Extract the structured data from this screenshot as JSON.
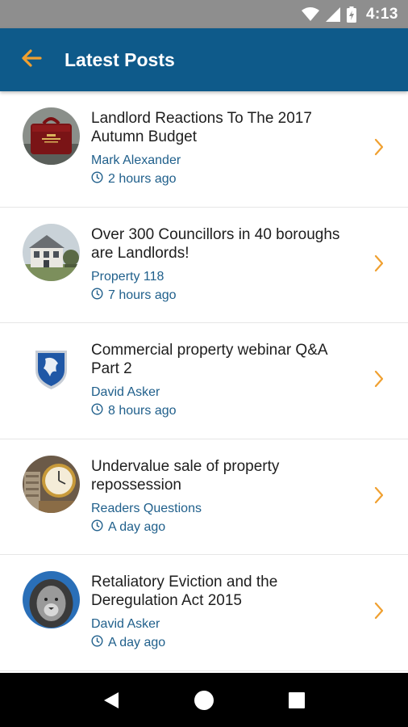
{
  "status_bar": {
    "time": "4:13",
    "icons": [
      "wifi-icon",
      "cell-signal-icon",
      "battery-charging-icon"
    ]
  },
  "app_bar": {
    "title": "Latest Posts",
    "back_icon": "arrow-left-icon",
    "accent_color": "#f0a030",
    "background_color": "#0e5a8a"
  },
  "posts": [
    {
      "title": "Landlord Reactions To The 2017 Autumn Budget",
      "author": "Mark Alexander",
      "time": "2 hours ago",
      "thumbnail": "budget-red-box-image"
    },
    {
      "title": "Over 300 Councillors in 40 boroughs are Landlords!",
      "author": "Property 118",
      "time": "7 hours ago",
      "thumbnail": "house-photo-image"
    },
    {
      "title": "Commercial property webinar Q&A Part 2",
      "author": "David Asker",
      "time": "8 hours ago",
      "thumbnail": "shield-logo-image"
    },
    {
      "title": "Undervalue sale of property repossession",
      "author": "Readers Questions",
      "time": "A day ago",
      "thumbnail": "clock-coins-image"
    },
    {
      "title": "Retaliatory Eviction and the Deregulation Act 2015",
      "author": "David Asker",
      "time": "A day ago",
      "thumbnail": "lion-photo-image"
    }
  ],
  "nav_bar": {
    "buttons": [
      "back-triangle-icon",
      "home-circle-icon",
      "recents-square-icon"
    ]
  }
}
